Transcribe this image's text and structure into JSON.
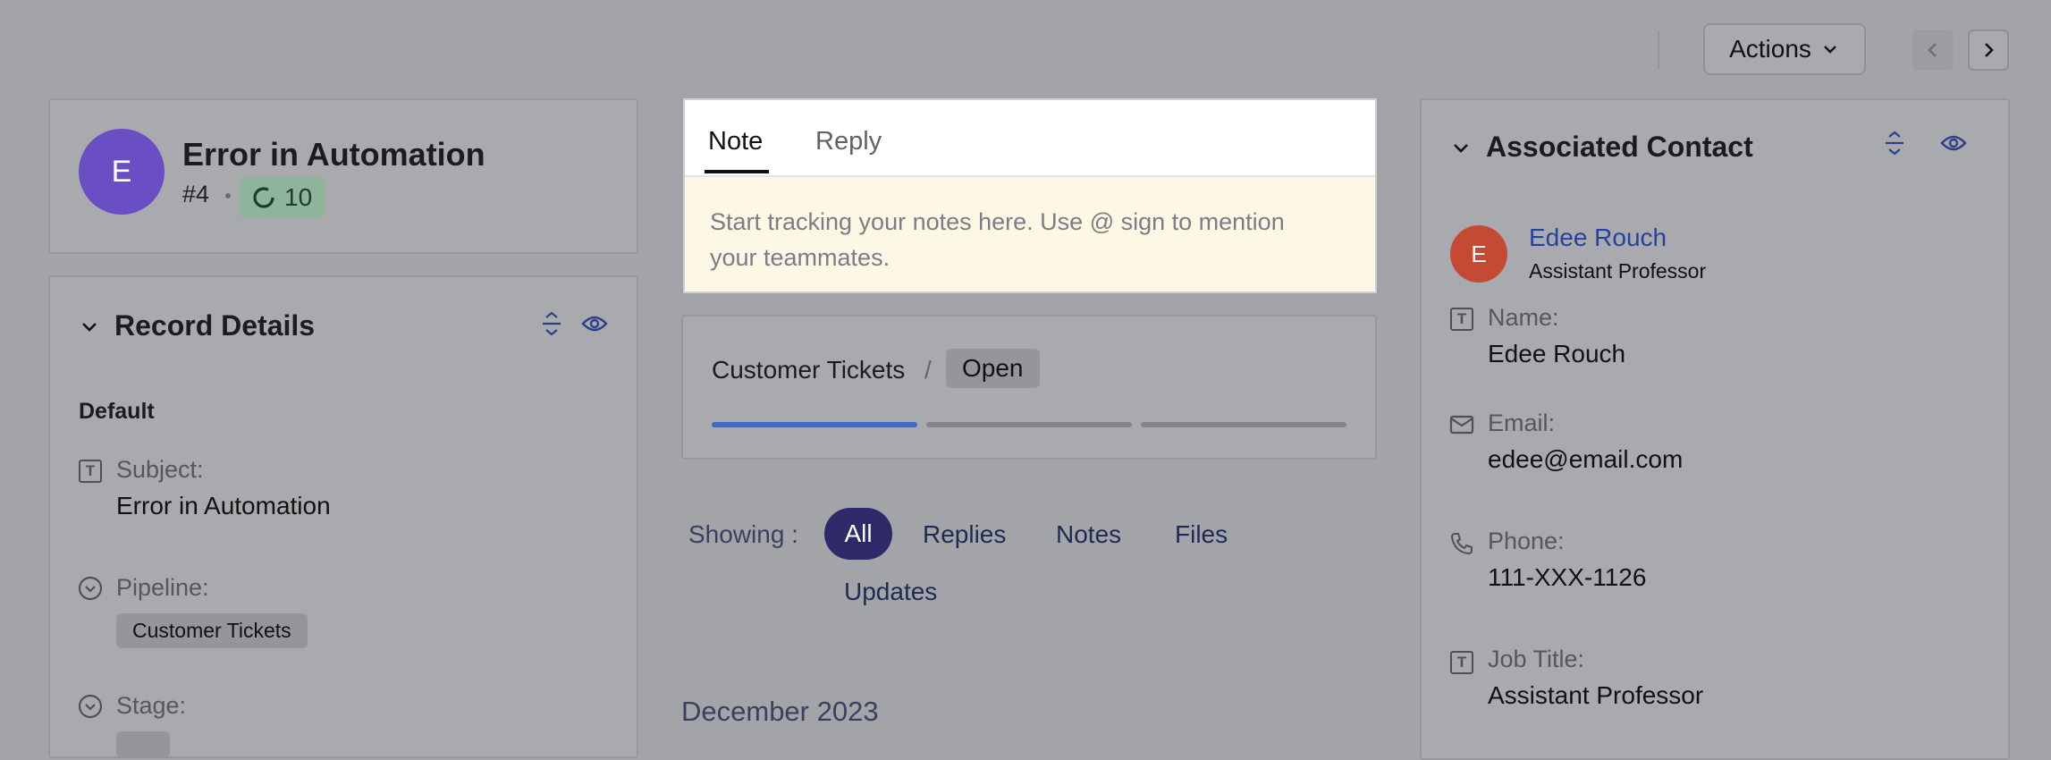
{
  "toolbar": {
    "actions_label": "Actions",
    "prev_icon": "chevron-left-icon",
    "next_icon": "chevron-right-icon"
  },
  "record": {
    "avatar_letter": "E",
    "title": "Error in Automation",
    "number": "#4",
    "score": "10"
  },
  "record_details": {
    "heading": "Record Details",
    "group": "Default",
    "fields": [
      {
        "label": "Subject:",
        "value": "Error in Automation",
        "icon": "text-field-icon"
      },
      {
        "label": "Pipeline:",
        "value": "Customer Tickets",
        "icon": "dropdown-field-icon"
      },
      {
        "label": "Stage:",
        "value": "",
        "icon": "dropdown-field-icon"
      }
    ]
  },
  "composer": {
    "tabs": [
      "Note",
      "Reply"
    ],
    "active_tab": "Note",
    "placeholder_line1": "Start tracking your notes here. Use @ sign to mention",
    "placeholder_line2": "your teammates."
  },
  "pipeline": {
    "name": "Customer Tickets",
    "separator": "/",
    "stage": "Open",
    "progress_segments_completed": 1,
    "progress_segments_total": 3
  },
  "filter": {
    "label": "Showing :",
    "options": [
      "All",
      "Replies",
      "Notes",
      "Files",
      "Updates"
    ],
    "active": "All"
  },
  "timeline": {
    "month": "December 2023"
  },
  "contact": {
    "heading": "Associated Contact",
    "avatar_letter": "E",
    "name": "Edee Rouch",
    "subtitle": "Assistant Professor",
    "fields": [
      {
        "label": "Name:",
        "value": "Edee Rouch",
        "icon": "text-field-icon"
      },
      {
        "label": "Email:",
        "value": "edee@email.com",
        "icon": "mail-icon"
      },
      {
        "label": "Phone:",
        "value": "111-XXX-1126",
        "icon": "phone-icon"
      },
      {
        "label": "Job Title:",
        "value": "Assistant Professor",
        "icon": "text-field-icon"
      }
    ]
  },
  "colors": {
    "accent": "#3d6ac9",
    "avatar_record": "#6a4fc4",
    "avatar_contact": "#c44a34",
    "note_bg": "#fdf7e6",
    "active_pill": "#2e2a6a"
  }
}
